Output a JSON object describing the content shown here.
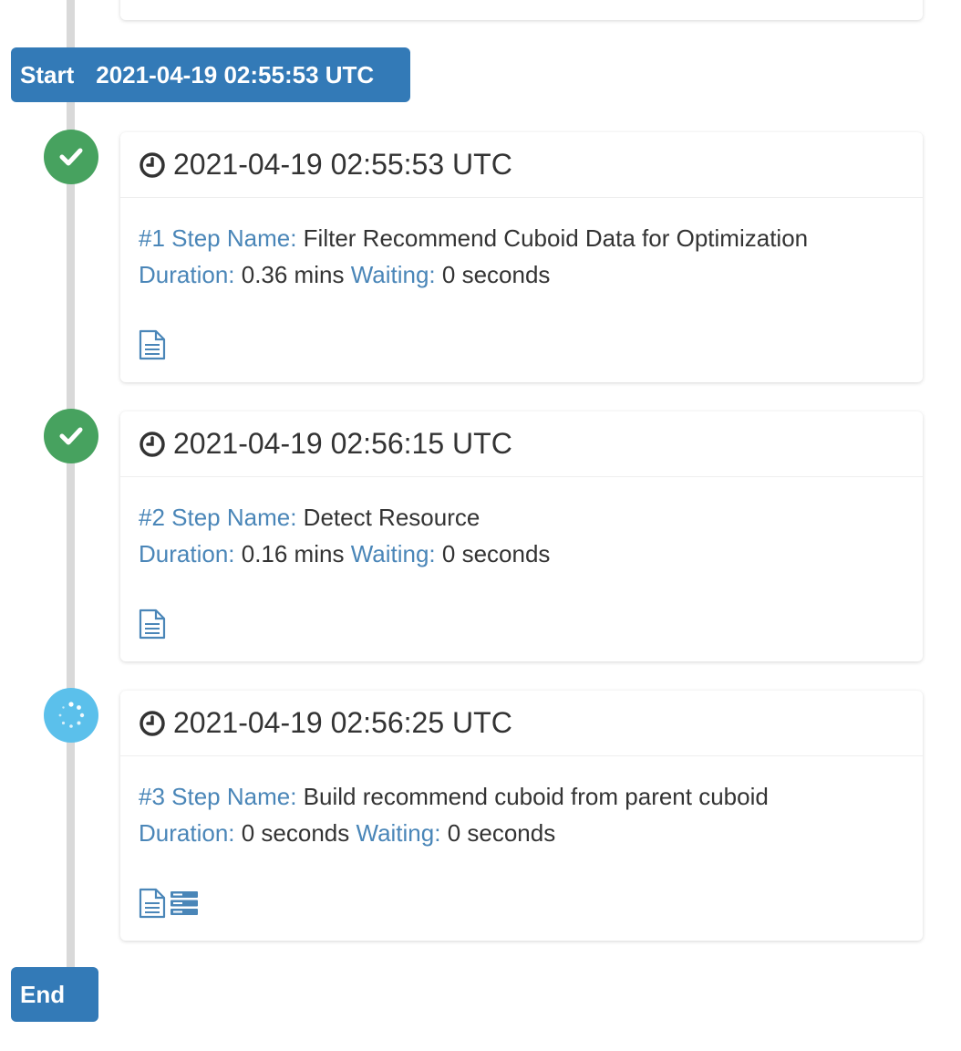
{
  "timeline": {
    "start": {
      "label": "Start",
      "time": "2021-04-19 02:55:53 UTC"
    },
    "end": {
      "label": "End"
    }
  },
  "steps": [
    {
      "status": "success",
      "time": "2021-04-19 02:55:53 UTC",
      "step_label": "#1 Step Name:",
      "step_name": "Filter Recommend Cuboid Data for Optimization",
      "duration_label": "Duration:",
      "duration": "0.36 mins",
      "waiting_label": "Waiting:",
      "waiting": "0 seconds",
      "icons": [
        "file-text-icon"
      ]
    },
    {
      "status": "success",
      "time": "2021-04-19 02:56:15 UTC",
      "step_label": "#2 Step Name:",
      "step_name": "Detect Resource",
      "duration_label": "Duration:",
      "duration": "0.16 mins",
      "waiting_label": "Waiting:",
      "waiting": "0 seconds",
      "icons": [
        "file-text-icon"
      ]
    },
    {
      "status": "running",
      "time": "2021-04-19 02:56:25 UTC",
      "step_label": "#3 Step Name:",
      "step_name": "Build recommend cuboid from parent cuboid",
      "duration_label": "Duration:",
      "duration": "0 seconds",
      "waiting_label": "Waiting:",
      "waiting": "0 seconds",
      "icons": [
        "file-text-icon",
        "server-icon"
      ]
    }
  ],
  "colors": {
    "primary": "#337ab7",
    "success": "#47a25f",
    "running": "#5bc0eb",
    "key_text": "#4a86b8",
    "timeline_line": "#d9d9d9"
  }
}
